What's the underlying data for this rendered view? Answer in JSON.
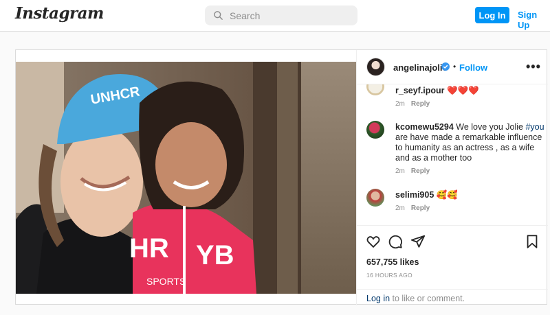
{
  "header": {
    "logo": "Instagram",
    "search_placeholder": "Search",
    "login_label": "Log In",
    "signup_label": "Sign Up"
  },
  "post": {
    "username": "angelinajolie",
    "follow_label": "Follow",
    "separator": "•",
    "more_label": "•••",
    "likes": "657,755 likes",
    "time_ago": "16 HOURS AGO",
    "login_prompt": {
      "link": "Log in",
      "text": " to like or comment."
    },
    "comments": [
      {
        "user": "r_seyf.ipour",
        "text": "❤️❤️❤️",
        "tag": "",
        "text2": "",
        "age": "2m",
        "reply": "Reply"
      },
      {
        "user": "kcomewu5294",
        "text": "We love you Jolie ",
        "tag": "#you",
        "text2": " are have made a remarkable influence to humanity as an actress , as a wife and as a mother too",
        "age": "2m",
        "reply": "Reply"
      },
      {
        "user": "selimi905",
        "text": "🥰🥰",
        "tag": "",
        "text2": "",
        "age": "2m",
        "reply": "Reply"
      }
    ]
  },
  "colors": {
    "accent": "#0095f6",
    "link": "#00376b",
    "muted": "#8e8e8e",
    "heart": "#ed4956"
  },
  "icons": [
    "search-icon",
    "verified-badge-icon",
    "more-options-icon",
    "heart-icon",
    "comment-icon",
    "share-icon",
    "bookmark-icon"
  ]
}
